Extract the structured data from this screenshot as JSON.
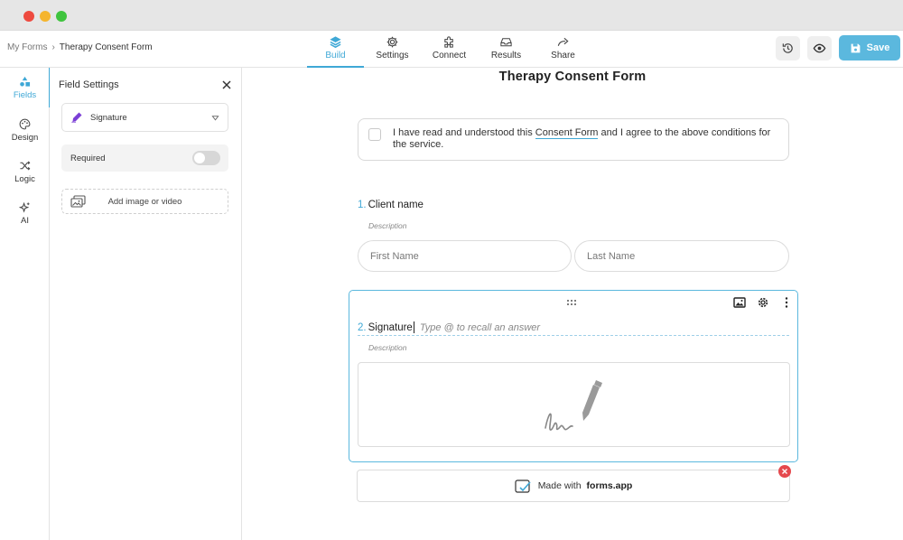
{
  "breadcrumb": {
    "root": "My Forms",
    "separator": "›",
    "current": "Therapy Consent Form"
  },
  "nav": {
    "tabs": [
      {
        "label": "Build",
        "icon": "layers-icon"
      },
      {
        "label": "Settings",
        "icon": "gear-icon"
      },
      {
        "label": "Connect",
        "icon": "puzzle-icon"
      },
      {
        "label": "Results",
        "icon": "inbox-icon"
      },
      {
        "label": "Share",
        "icon": "share-arrow-icon"
      }
    ]
  },
  "actions": {
    "save_label": "Save"
  },
  "rail": {
    "items": [
      {
        "label": "Fields",
        "icon": "shapes-icon"
      },
      {
        "label": "Design",
        "icon": "palette-icon"
      },
      {
        "label": "Logic",
        "icon": "shuffle-icon"
      },
      {
        "label": "AI",
        "icon": "sparkles-icon"
      }
    ]
  },
  "panel": {
    "title": "Field Settings",
    "field_type": "Signature",
    "required_label": "Required",
    "required": false,
    "add_media_label": "Add image or video"
  },
  "form": {
    "title": "Therapy Consent Form",
    "consent": {
      "before": "I have read and understood this ",
      "link": "Consent Form",
      "after": " and I agree to the above conditions for the service."
    },
    "q1": {
      "number": "1.",
      "label": "Client name",
      "description": "Description",
      "first_placeholder": "First Name",
      "last_placeholder": "Last Name"
    },
    "q2": {
      "number": "2.",
      "label": "Signature",
      "placeholder": "Type @ to recall an answer",
      "description": "Description"
    },
    "branding": {
      "prefix": "Made with",
      "brand": "forms.app"
    }
  },
  "colors": {
    "accent": "#3fa8d6",
    "save": "#5bb8de",
    "remove": "#e5484d"
  }
}
